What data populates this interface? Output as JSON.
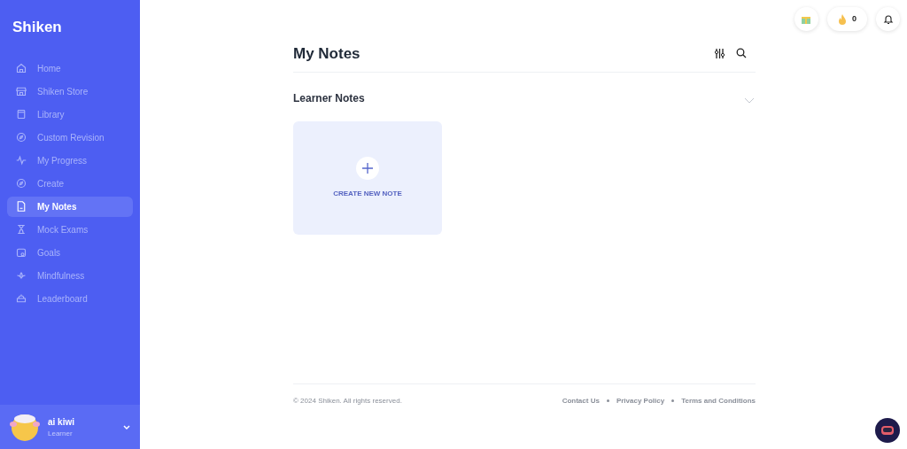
{
  "brand": "Shiken",
  "nav": [
    {
      "label": "Home",
      "selected": false
    },
    {
      "label": "Shiken Store",
      "selected": false
    },
    {
      "label": "Library",
      "selected": false
    },
    {
      "label": "Custom Revision",
      "selected": false
    },
    {
      "label": "My Progress",
      "selected": false
    },
    {
      "label": "Create",
      "selected": false
    },
    {
      "label": "My Notes",
      "selected": true
    },
    {
      "label": "Mock Exams",
      "selected": false
    },
    {
      "label": "Goals",
      "selected": false
    },
    {
      "label": "Mindfulness",
      "selected": false
    },
    {
      "label": "Leaderboard",
      "selected": false
    }
  ],
  "user": {
    "name": "ai kiwi",
    "role": "Learner"
  },
  "streak": "0",
  "title": "My Notes",
  "section": {
    "title": "Learner Notes",
    "create_label": "CREATE NEW NOTE"
  },
  "footer": {
    "copyright": "© 2024 Shiken. All rights reserved.",
    "links": [
      "Contact Us",
      "Privacy Policy",
      "Terms and Conditions"
    ]
  }
}
